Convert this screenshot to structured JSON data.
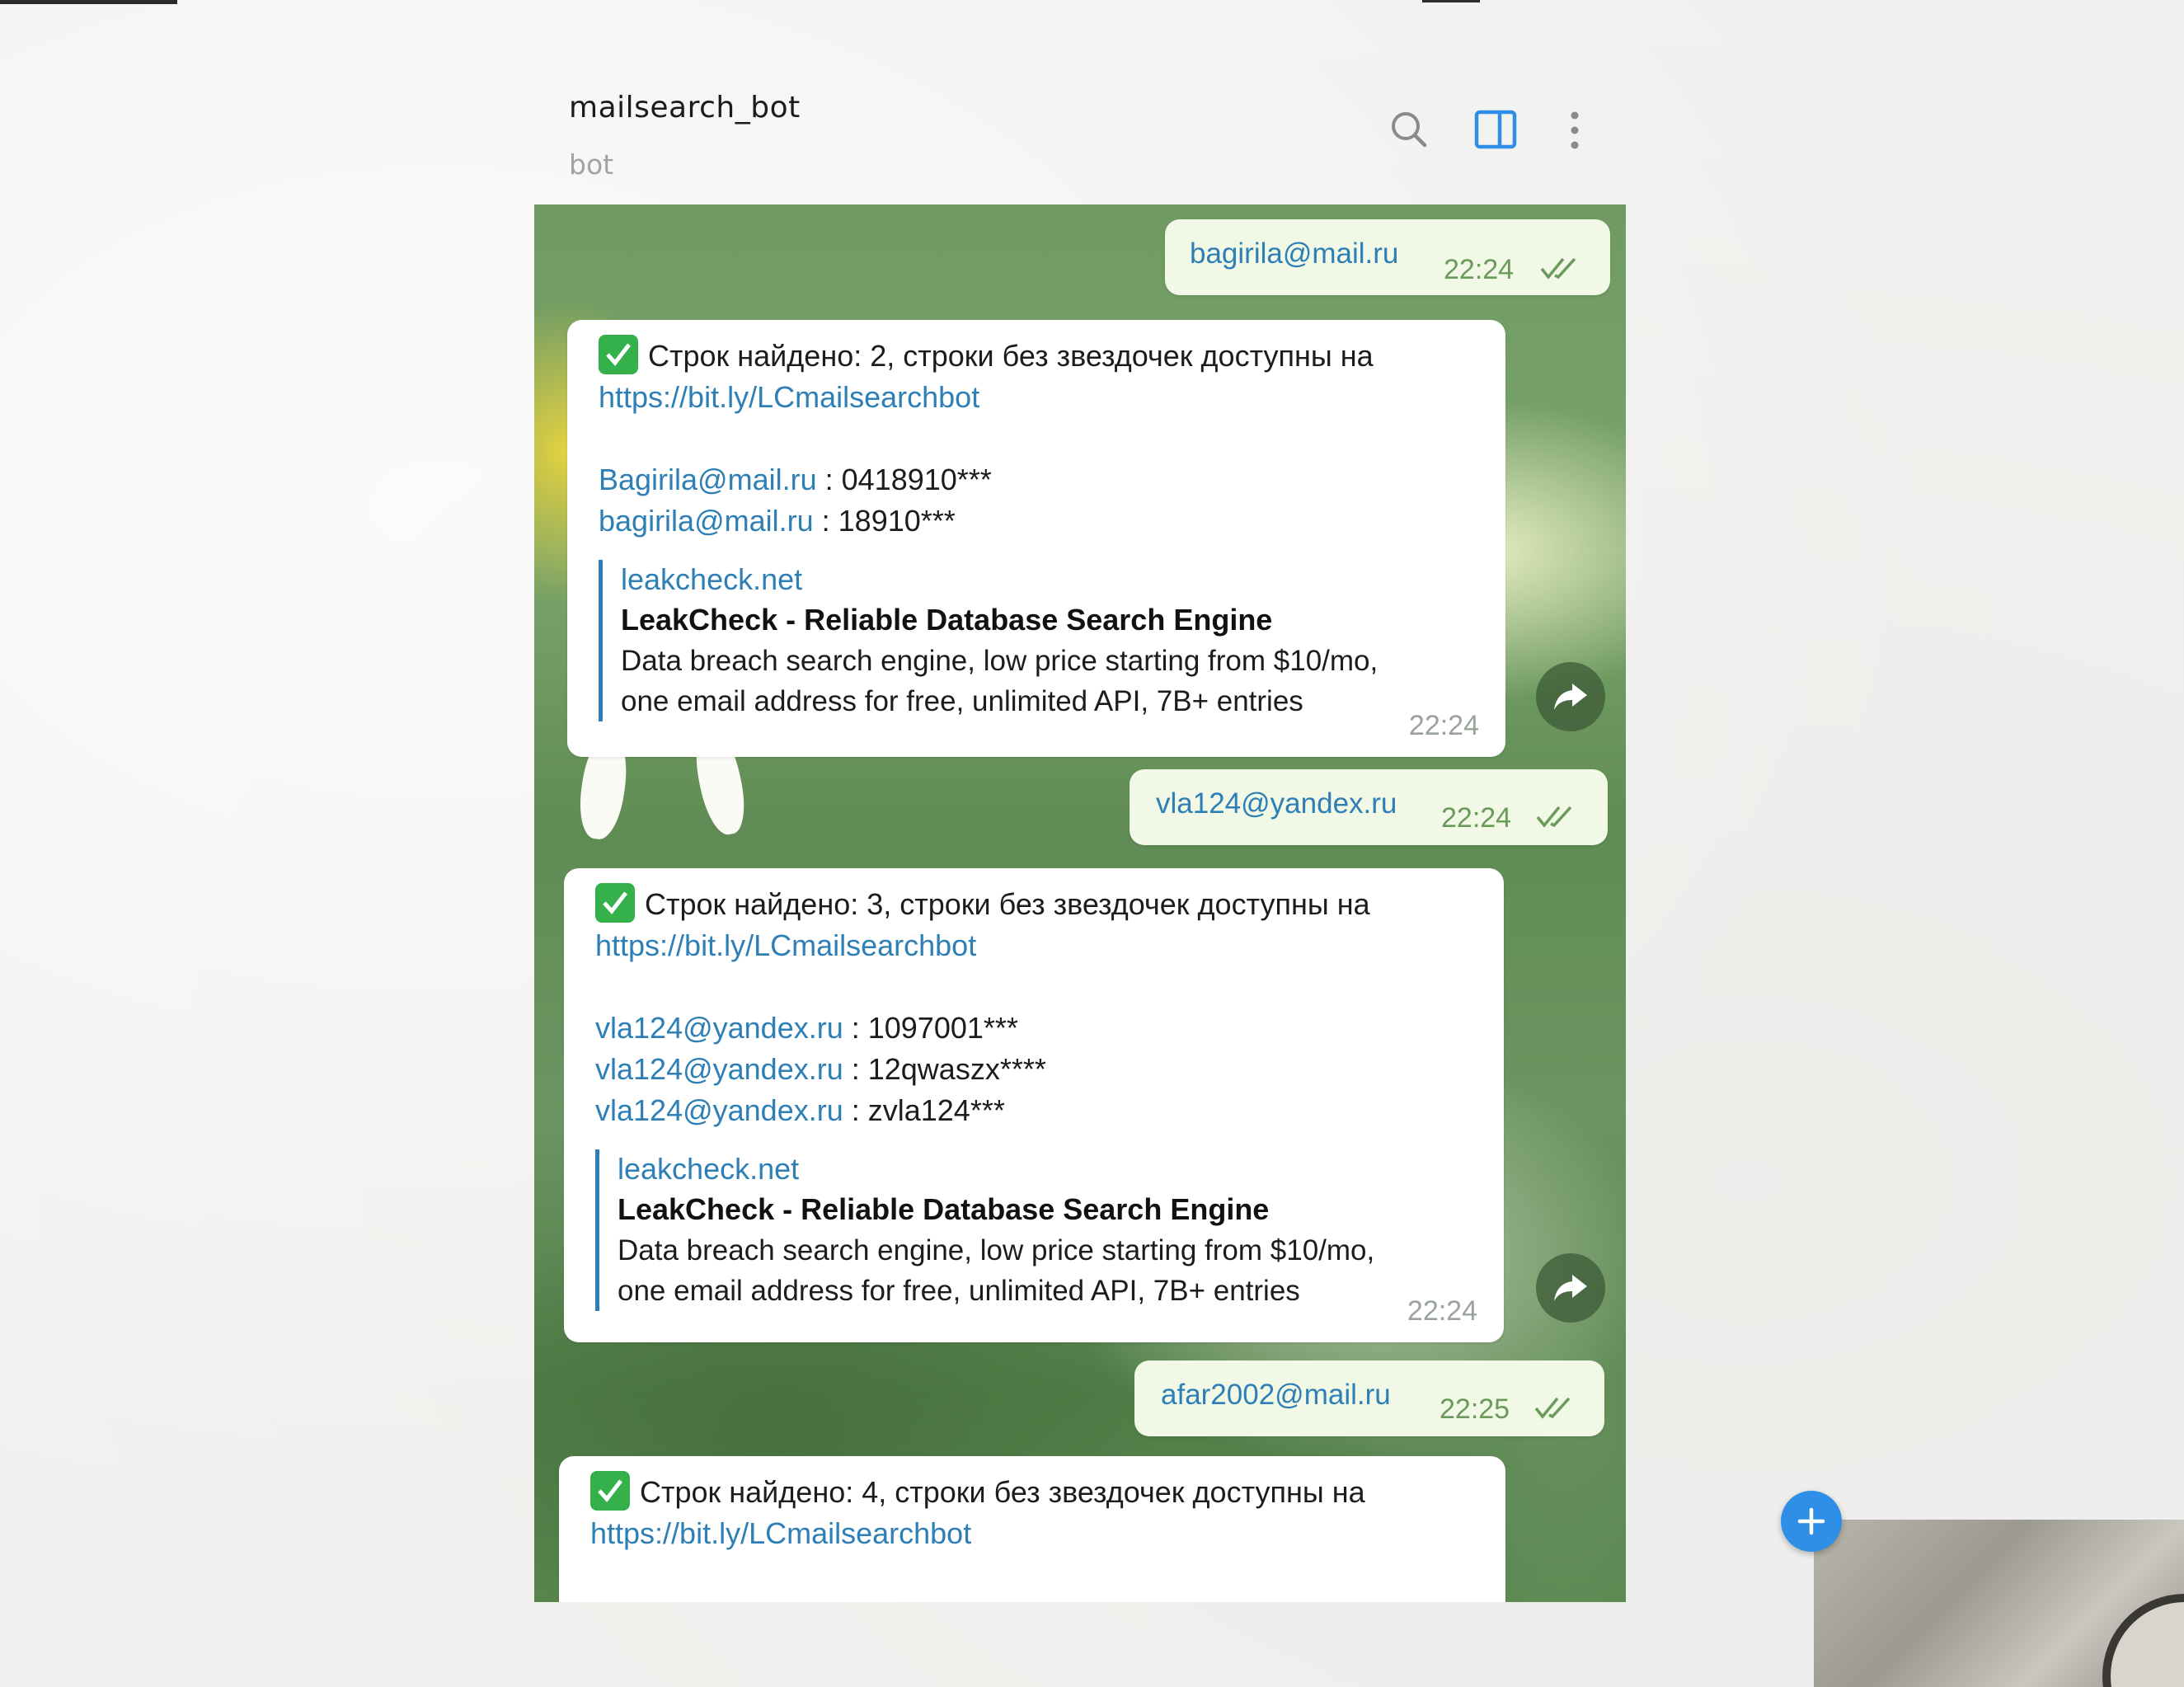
{
  "header": {
    "title": "mailsearch_bot",
    "subtitle": "bot",
    "icons": [
      "search-icon",
      "sidebar-panel-icon",
      "more-vertical-icon"
    ]
  },
  "messages": [
    {
      "direction": "out",
      "text": "bagirila@mail.ru",
      "time": "22:24"
    },
    {
      "direction": "in",
      "status_line": "Строк найдено: 2, строки без звездочек доступны на",
      "link": "https://bit.ly/LCmailsearchbot",
      "results": [
        {
          "email": "Bagirila@mail.ru",
          "value": " : 0418910***"
        },
        {
          "email": "bagirila@mail.ru",
          "value": " : 18910***"
        }
      ],
      "preview": {
        "site": "leakcheck.net",
        "title": "LeakCheck - Reliable Database Search Engine",
        "desc1": "Data breach search engine, low price starting from $10/mo,",
        "desc2": "one email address for free, unlimited API, 7B+ entries"
      },
      "time": "22:24"
    },
    {
      "direction": "out",
      "text": "vla124@yandex.ru",
      "time": "22:24"
    },
    {
      "direction": "in",
      "status_line": "Строк найдено: 3, строки без звездочек доступны на",
      "link": "https://bit.ly/LCmailsearchbot",
      "results": [
        {
          "email": "vla124@yandex.ru",
          "value": " : 1097001***"
        },
        {
          "email": "vla124@yandex.ru",
          "value": " : 12qwaszx****"
        },
        {
          "email": "vla124@yandex.ru",
          "value": " : zvla124***"
        }
      ],
      "preview": {
        "site": "leakcheck.net",
        "title": "LeakCheck - Reliable Database Search Engine",
        "desc1": "Data breach search engine, low price starting from $10/mo,",
        "desc2": "one email address for free, unlimited API, 7B+ entries"
      },
      "time": "22:24"
    },
    {
      "direction": "out",
      "text": "afar2002@mail.ru",
      "time": "22:25"
    },
    {
      "direction": "in",
      "status_line": "Строк найдено: 4, строки без звездочек доступны на",
      "link": "https://bit.ly/LCmailsearchbot"
    }
  ],
  "colors": {
    "link": "#2d7fb5",
    "outgoing_bubble": "#f1f8e6",
    "check_green": "#34b14a",
    "fab_blue": "#2f8fe6"
  }
}
